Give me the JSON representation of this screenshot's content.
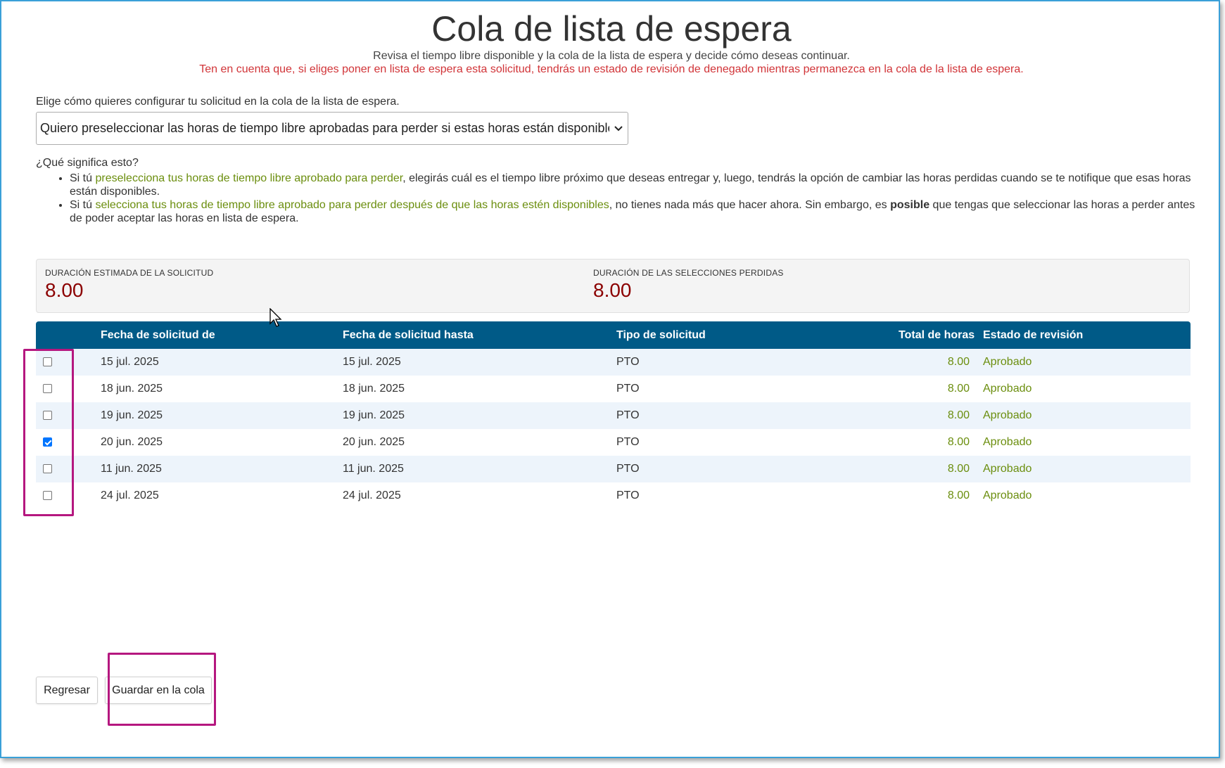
{
  "page": {
    "title": "Cola de lista de espera",
    "subtitle": "Revisa el tiempo libre disponible y la cola de la lista de espera y decide cómo deseas continuar.",
    "warning": "Ten en cuenta que, si eliges poner en lista de espera esta solicitud, tendrás un estado de revisión de denegado mientras permanezca en la cola de la lista de espera."
  },
  "config": {
    "label": "Elige cómo quieres configurar tu solicitud en la cola de la lista de espera.",
    "selected": "Quiero preseleccionar las horas de tiempo libre aprobadas para perder si estas horas están disponibles."
  },
  "help": {
    "title": "¿Qué significa esto?",
    "item1": {
      "prefix": "Si tú ",
      "link": "preselecciona tus horas de tiempo libre aprobado para perder",
      "suffix": ", elegirás cuál es el tiempo libre próximo que deseas entregar y, luego, tendrás la opción de cambiar las horas perdidas cuando se te notifique que esas horas están disponibles."
    },
    "item2": {
      "prefix": "Si tú ",
      "link": "selecciona tus horas de tiempo libre aprobado para perder después de que las horas estén disponibles",
      "middle": ", no tienes nada más que hacer ahora. Sin embargo, es ",
      "bold": "posible",
      "suffix": " que tengas que seleccionar las horas a perder antes de poder aceptar las horas en lista de espera."
    }
  },
  "summary": {
    "estimated_label": "DURACIÓN ESTIMADA DE LA SOLICITUD",
    "estimated_value": "8.00",
    "forfeit_label": "DURACIÓN DE LAS SELECCIONES PERDIDAS",
    "forfeit_value": "8.00"
  },
  "table": {
    "headers": {
      "from": "Fecha de solicitud de",
      "to": "Fecha de solicitud hasta",
      "type": "Tipo de solicitud",
      "hours": "Total de horas",
      "status": "Estado de revisión"
    },
    "rows": [
      {
        "checked": false,
        "from": "15 jul. 2025",
        "to": "15 jul. 2025",
        "type": "PTO",
        "hours": "8.00",
        "status": "Aprobado"
      },
      {
        "checked": false,
        "from": "18 jun. 2025",
        "to": "18 jun. 2025",
        "type": "PTO",
        "hours": "8.00",
        "status": "Aprobado"
      },
      {
        "checked": false,
        "from": "19 jun. 2025",
        "to": "19 jun. 2025",
        "type": "PTO",
        "hours": "8.00",
        "status": "Aprobado"
      },
      {
        "checked": true,
        "from": "20 jun. 2025",
        "to": "20 jun. 2025",
        "type": "PTO",
        "hours": "8.00",
        "status": "Aprobado"
      },
      {
        "checked": false,
        "from": "11 jun. 2025",
        "to": "11 jun. 2025",
        "type": "PTO",
        "hours": "8.00",
        "status": "Aprobado"
      },
      {
        "checked": false,
        "from": "24 jul. 2025",
        "to": "24 jul. 2025",
        "type": "PTO",
        "hours": "8.00",
        "status": "Aprobado"
      }
    ]
  },
  "actions": {
    "back_label": "Regresar",
    "save_label": "Guardar en la cola"
  },
  "colors": {
    "header_bg": "#005a87",
    "accent_green": "#6b8e0e",
    "warning_red": "#d13438",
    "value_red": "#8b0000",
    "highlight_magenta": "#b5177f"
  }
}
